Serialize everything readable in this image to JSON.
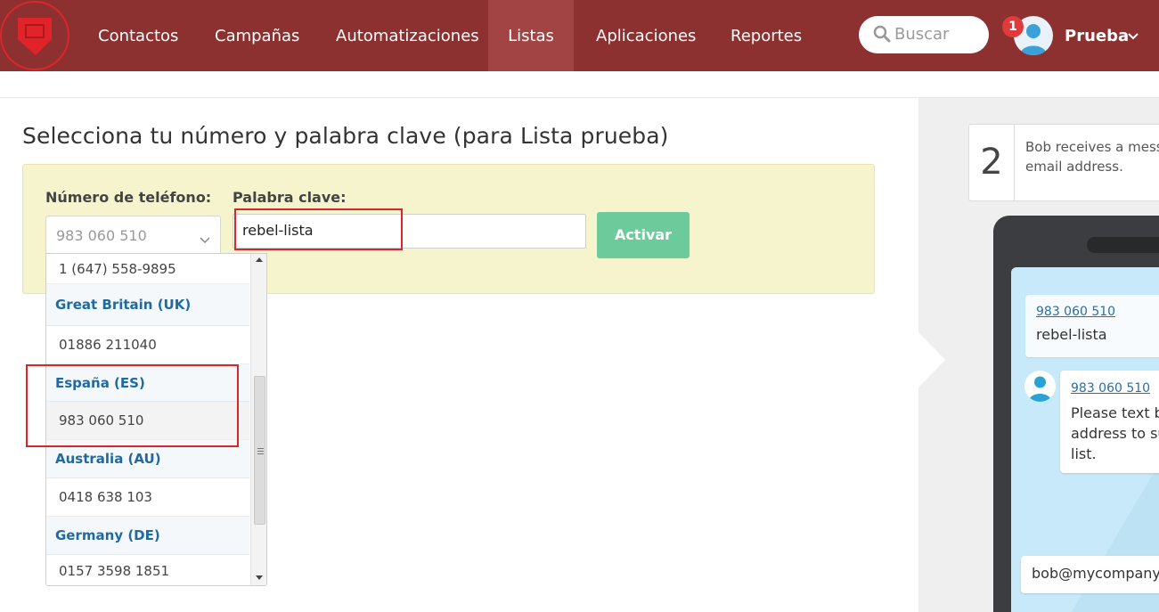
{
  "nav": {
    "items": [
      {
        "label": "Contactos"
      },
      {
        "label": "Campañas"
      },
      {
        "label": "Automatizaciones"
      },
      {
        "label": "Listas"
      },
      {
        "label": "Aplicaciones"
      },
      {
        "label": "Reportes"
      }
    ],
    "active": "Listas",
    "search_placeholder": "Buscar",
    "notification_count": "1",
    "username": "Prueba"
  },
  "colors": {
    "nav_bg": "#8c3030",
    "nav_active": "#a24444",
    "panel_bg": "#f6f4cc",
    "button_green": "#6dcb9b",
    "highlight_red": "#d8262b",
    "group_blue": "#1f6aa0"
  },
  "main": {
    "title": "Selecciona tu número y palabra clave (para Lista prueba)",
    "phone_label": "Número de teléfono:",
    "keyword_label": "Palabra clave:",
    "selected_phone": "983 060 510",
    "keyword_value": "rebel-lista",
    "activate_label": "Activar"
  },
  "dropdown": {
    "top_option": "1 (647) 558-9895",
    "groups": [
      {
        "label": "Great Britain (UK)",
        "option": "01886 211040"
      },
      {
        "label": "España (ES)",
        "option": "983 060 510"
      },
      {
        "label": "Australia (AU)",
        "option": "0418 638 103"
      },
      {
        "label": "Germany (DE)",
        "option": "0157 3598 1851"
      }
    ]
  },
  "preview": {
    "step_number": "2",
    "step_text_line1": "Bob receives a mess",
    "step_text_line2": "email address.",
    "msg1_sender": "983 060 510",
    "msg1_text": "rebel-lista",
    "msg2_sender": "983 060 510",
    "msg2_line1": "Please text ba",
    "msg2_line2": "address to su",
    "msg2_line3": "list.",
    "msg3_text": "bob@mycompany."
  }
}
